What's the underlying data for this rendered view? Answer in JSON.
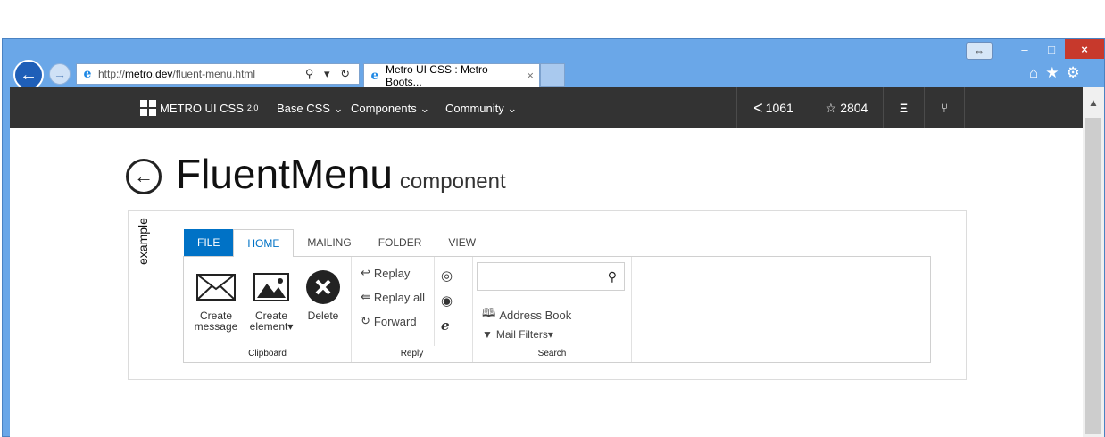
{
  "browser": {
    "url_prefix": "http://",
    "url_host": "metro.dev",
    "url_path": "/fluent-menu.html",
    "address_tools": "⚲ ▾ ↻",
    "tab_title": "Metro UI CSS : Metro Boots...",
    "tab_close": "×"
  },
  "nav": {
    "brand": "METRO UI CSS",
    "brand_version": "2.0",
    "items": [
      "Base CSS ⌄",
      "Components ⌄",
      "Community ⌄"
    ],
    "share_count": "1061",
    "star_count": "2804"
  },
  "page": {
    "title": "FluentMenu",
    "subtitle": "component",
    "example_label": "example"
  },
  "fluent_menu": {
    "tabs": [
      "FILE",
      "HOME",
      "MAILING",
      "FOLDER",
      "VIEW"
    ],
    "active_tab": "HOME",
    "clipboard": {
      "create_message": "Create message",
      "create_element": "Create element▾",
      "delete": "Delete",
      "caption": "Clipboard"
    },
    "reply": {
      "replay": "Replay",
      "replay_all": "Replay all",
      "forward": "Forward",
      "caption": "Reply"
    },
    "search": {
      "value": "",
      "address_book": "Address Book",
      "mail_filters": "Mail Filters▾",
      "caption": "Search"
    }
  }
}
